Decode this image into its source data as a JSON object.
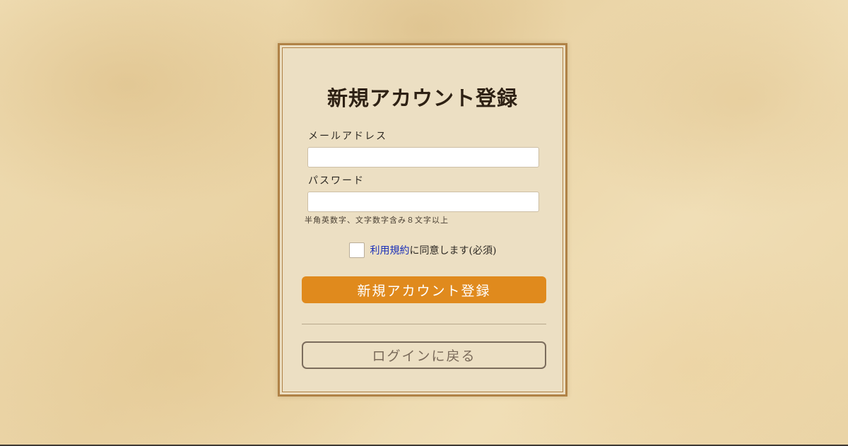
{
  "signup_form": {
    "title": "新規アカウント登録",
    "email": {
      "label": "メールアドレス",
      "value": "",
      "placeholder": ""
    },
    "password": {
      "label": "パスワード",
      "value": "",
      "placeholder": "",
      "hint": "半角英数字、文字数字含み８文字以上"
    },
    "agreement": {
      "checked": false,
      "link_text": "利用規約",
      "text": "に同意します(必須)"
    },
    "submit_label": "新規アカウント登録",
    "back_label": "ログインに戻る"
  },
  "colors": {
    "accent": "#e08a1d",
    "frame": "#b08246",
    "link": "#1a2fb8"
  }
}
